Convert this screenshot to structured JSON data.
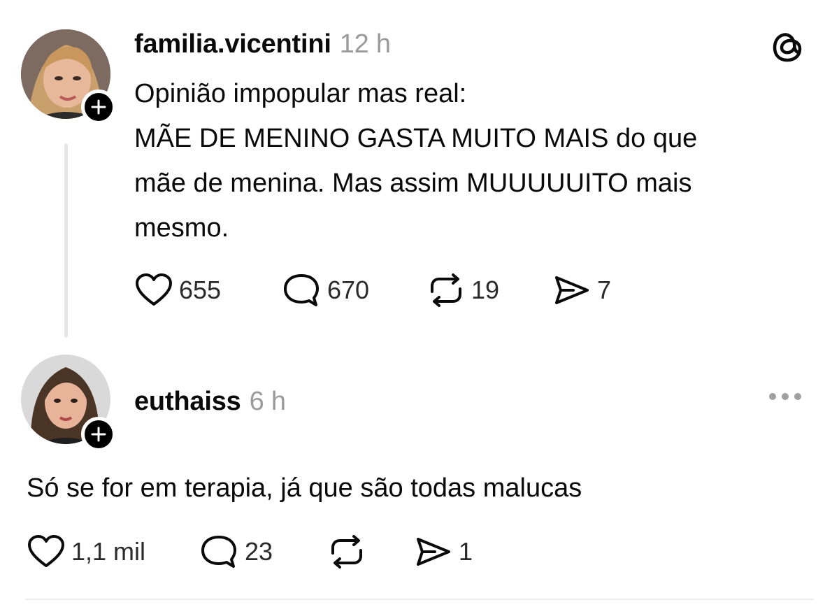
{
  "post": {
    "username": "familia.vicentini",
    "time": "12 h",
    "text_lines": [
      "Opinião impopular mas real:",
      "MÃE DE MENINO GASTA MUITO MAIS do que",
      "mãe de menina. Mas assim MUUUUUITO mais",
      "mesmo."
    ],
    "likes": "655",
    "replies": "670",
    "reposts": "19",
    "shares": "7"
  },
  "reply": {
    "username": "euthaiss",
    "time": "6 h",
    "text": "Só se for em terapia, já que são todas malucas",
    "likes": "1,1 mil",
    "replies": "23",
    "shares": "1"
  },
  "icons": {
    "app_logo": "threads-logo-icon",
    "like": "heart-icon",
    "reply": "speech-bubble-icon",
    "repost": "repost-icon",
    "share": "send-icon",
    "follow": "plus-icon",
    "more": "more-icon"
  }
}
